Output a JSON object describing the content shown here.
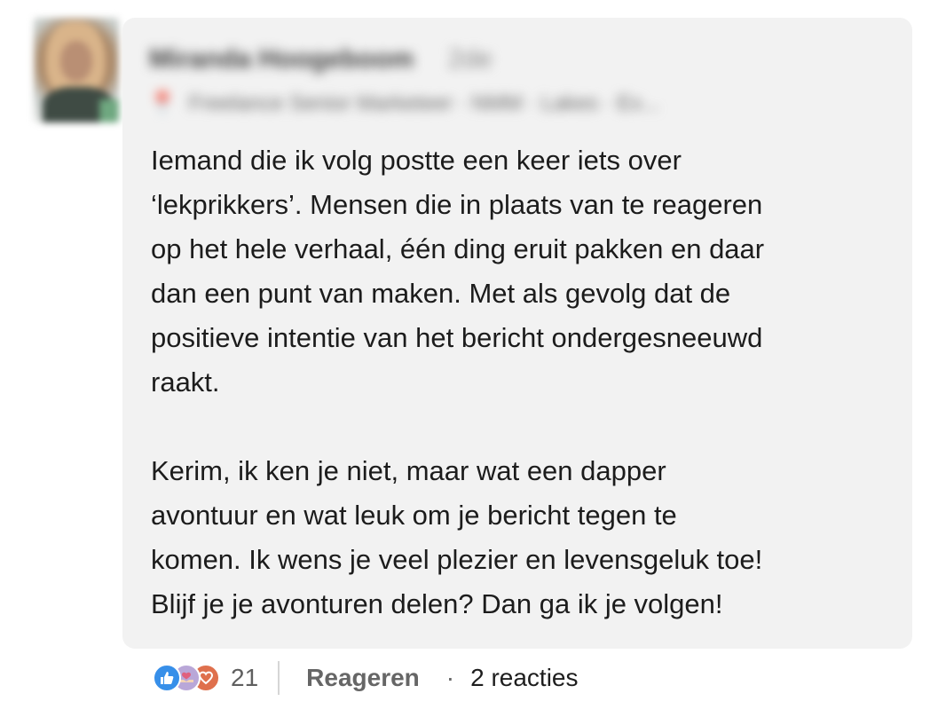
{
  "comment": {
    "author_name": "Miranda Hoogeboom",
    "author_degree": "2de",
    "author_headline": "Freelance Senior Marketeer · NMM · Lakes · Ex...",
    "paragraphs": [
      "Iemand die ik volg postte een keer iets over\n‘lekprikkers’. Mensen die in plaats van te reageren\nop het hele verhaal, één ding eruit pakken en daar\ndan een punt van maken. Met als gevolg dat de\npositieve intentie van het bericht ondergesneeuwd\nraakt.",
      "Kerim, ik ken je niet, maar wat een dapper\navontuur en wat leuk om je bericht tegen te\nkomen. Ik wens je veel plezier en levensgeluk toe!\nBlijf je je avonturen delen? Dan ga ik je volgen!"
    ]
  },
  "footer": {
    "reaction_icons": [
      "like-icon",
      "support-icon",
      "love-icon"
    ],
    "reaction_count": "21",
    "reply_label": "Reageren",
    "separator": "·",
    "replies_label": "2 reacties"
  },
  "colors": {
    "bubble_background": "#f2f2f2",
    "like": "#378fe9",
    "support": "#b9a7d8",
    "love": "#df704d"
  }
}
